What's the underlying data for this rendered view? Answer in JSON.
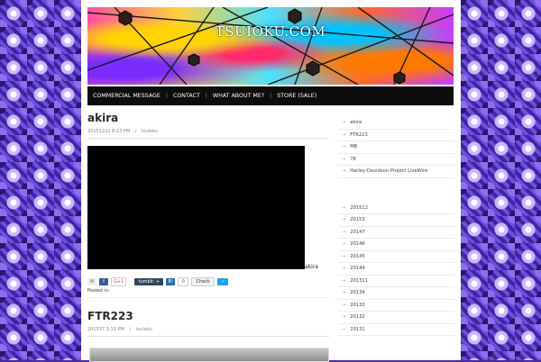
{
  "site": {
    "title": "TSUIOKU.COM"
  },
  "nav": {
    "items": [
      "COMMERCIAL MESSAGE",
      "CONTACT",
      "WHAT ABOUT ME?",
      "STORE (SALE)"
    ]
  },
  "posts": [
    {
      "title": "akira",
      "date": "20151222 8:13 PM",
      "author": "tsuioku",
      "caption": "akira",
      "posted_in": "Posted in:"
    },
    {
      "title": "FTR223",
      "date": "201537 3:13 PM",
      "author": "tsuioku"
    }
  ],
  "share": {
    "tumblr": "tumblr. +",
    "hatena_count": "0",
    "check": "Check",
    "gplus": "G+1"
  },
  "sidebar": {
    "recent": [
      "akira",
      "FTR223",
      "MB",
      "78",
      "Harley-Davidson Project LiveWire"
    ],
    "archives": [
      "201512",
      "20153",
      "20147",
      "20146",
      "20145",
      "20144",
      "201311",
      "20134",
      "20133",
      "20132",
      "20131"
    ]
  }
}
